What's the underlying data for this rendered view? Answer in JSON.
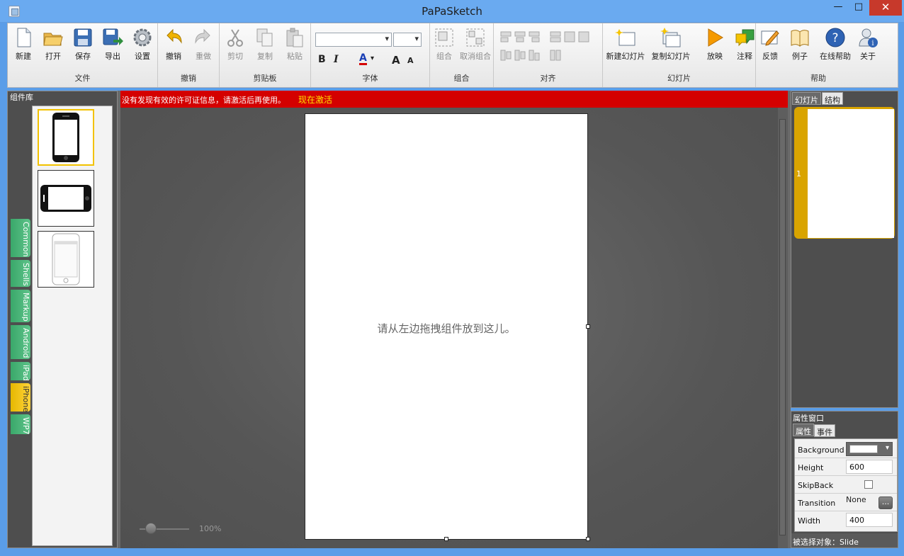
{
  "window": {
    "title": "PaPaSketch",
    "min": "—",
    "max": "□",
    "close": "✕"
  },
  "ribbon": {
    "file": {
      "label": "文件",
      "new": "新建",
      "open": "打开",
      "save": "保存",
      "export": "导出",
      "settings": "设置"
    },
    "undo": {
      "label": "撤销",
      "undo": "撤销",
      "redo": "重做"
    },
    "clipboard": {
      "label": "剪贴板",
      "cut": "剪切",
      "copy": "复制",
      "paste": "粘贴"
    },
    "font": {
      "label": "字体",
      "bold": "B",
      "italic": "I",
      "color": "A",
      "grow": "A",
      "shrink": "A"
    },
    "group": {
      "label": "组合",
      "group": "组合",
      "ungroup": "取消组合"
    },
    "align": {
      "label": "对齐"
    },
    "slides": {
      "label": "幻灯片",
      "new_slide": "新建幻灯片",
      "copy_slide": "复制幻灯片",
      "play": "放映",
      "annotate": "注释"
    },
    "help": {
      "label": "帮助",
      "feedback": "反馈",
      "examples": "例子",
      "online_help": "在线帮助",
      "about": "关于"
    }
  },
  "library": {
    "title": "组件库",
    "tabs": [
      "Common",
      "Shells",
      "Markup",
      "Android",
      "iPad",
      "iPhone",
      "WP7"
    ],
    "active_tab": "iPhone"
  },
  "license": {
    "message": "没有发现有效的许可证信息，请激活后再使用。",
    "activate": "现在激活"
  },
  "canvas": {
    "hint": "请从左边拖拽组件放到这儿。",
    "zoom": "100%"
  },
  "slides_panel": {
    "tab_slides": "幻灯片",
    "tab_structure": "结构",
    "slide_number": "1"
  },
  "properties": {
    "title": "属性窗口",
    "tab_props": "属性",
    "tab_events": "事件",
    "rows": [
      {
        "name": "Background",
        "value": ""
      },
      {
        "name": "Height",
        "value": "600"
      },
      {
        "name": "SkipBack",
        "value": ""
      },
      {
        "name": "Transition",
        "value": "None"
      },
      {
        "name": "Width",
        "value": "400"
      }
    ],
    "ellipsis": "...",
    "status": "被选择对象：Slide"
  },
  "colors": {
    "license_bar": "#d40000",
    "accent_yellow": "#f2c200",
    "tab_green": "#3aa86a"
  }
}
